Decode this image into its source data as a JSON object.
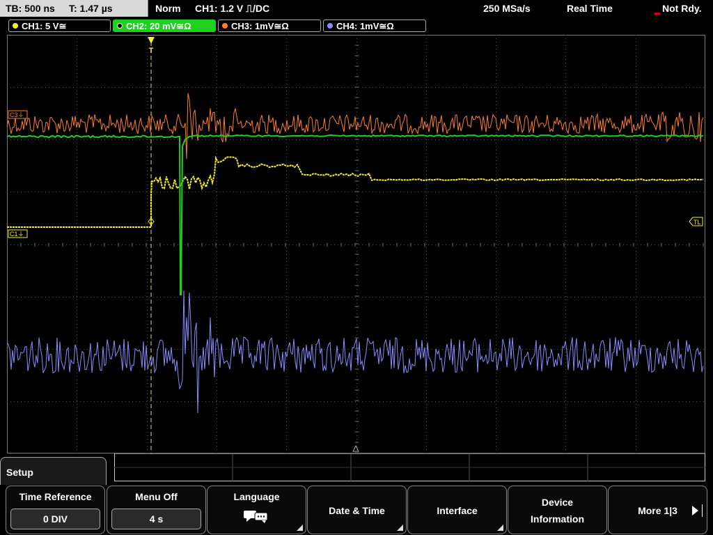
{
  "status_bar": {
    "timebase": "TB: 500 ns",
    "trigger_time": "T: 1.47 µs",
    "trigger_mode": "Norm",
    "trigger_source": "CH1: 1.2 V ⎍/DC",
    "sample_rate": "250 MSa/s",
    "acq_mode": "Real Time",
    "run_state": "Not Rdy."
  },
  "channels": [
    {
      "label": "CH1: 5 V≅",
      "color": "#f3ef2a",
      "active": false
    },
    {
      "label": "CH2: 20 mV≅Ω",
      "color": "#1fd01f",
      "active": true
    },
    {
      "label": "CH3: 1mV≅Ω",
      "color": "#ff7f27",
      "active": false
    },
    {
      "label": "CH4: 1mV≅Ω",
      "color": "#8c8cff",
      "active": false
    }
  ],
  "markers": {
    "c3": "C3⏚",
    "c1": "C1⏚",
    "tl": "TL",
    "trigger": "T"
  },
  "menu": {
    "title": "Setup",
    "buttons": [
      {
        "label": "Time Reference",
        "value": "0 DIV"
      },
      {
        "label": "Menu Off",
        "value": "4 s"
      },
      {
        "label": "Language",
        "icon": "speech-bubbles-icon"
      },
      {
        "label": "Date & Time"
      },
      {
        "label": "Interface"
      },
      {
        "label": "Device",
        "label2": "Information"
      },
      {
        "label": "More 1|3"
      }
    ]
  },
  "colors": {
    "ch1": "#f3ef2a",
    "ch2": "#1fd01f",
    "ch3": "#ff7f27",
    "ch4": "#8c8cff",
    "grid": "#5a5a5a",
    "trigger_line": "#e8e840"
  }
}
